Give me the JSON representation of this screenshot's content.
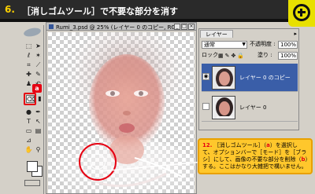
{
  "header": {
    "step_number": "6.",
    "title": "［消しゴムツール］で不要な部分を消す"
  },
  "toolbox": {
    "tools": [
      "marquee",
      "move",
      "lasso",
      "magic-wand",
      "crop",
      "slice",
      "healing",
      "brush",
      "stamp",
      "history",
      "eraser",
      "gradient",
      "dodge",
      "pen",
      "type",
      "path",
      "shape",
      "notes",
      "eyedropper",
      "hand",
      "zoom"
    ],
    "active_tool": "eraser",
    "annotation_label": "a"
  },
  "document": {
    "title": "Rumi_3.psd @ 25% (レイヤー 0 のコピー, RGB/8)",
    "controls": [
      "minimize",
      "maximize",
      "close"
    ]
  },
  "layers_panel": {
    "tab_label": "レイヤー",
    "blend_mode": "通常",
    "opacity_label": "不透明度 :",
    "opacity_value": "100%",
    "lock_label": "ロック :",
    "fill_label": "塗り :",
    "fill_value": "100%",
    "layers": [
      {
        "name": "レイヤー 0 のコピー",
        "visible": true,
        "selected": true
      },
      {
        "name": "レイヤー 0",
        "visible": false,
        "selected": false
      }
    ]
  },
  "callout": {
    "number": "12.",
    "text_1": "［消しゴムツール］（",
    "marker_a": "a",
    "text_2": "）を選択して、オプションバーで［モード］を［ブラシ］にして、画像の不要な部分を削除（",
    "marker_b": "b",
    "text_3": "）する。ここはかなり大雑把で構いません。"
  },
  "colors": {
    "banner": "#2a2a2a",
    "title_yellow": "#ffd200",
    "highlight_red": "#e60012",
    "callout_fill": "#ffc72c",
    "selection_blue": "#3a5ea8"
  }
}
